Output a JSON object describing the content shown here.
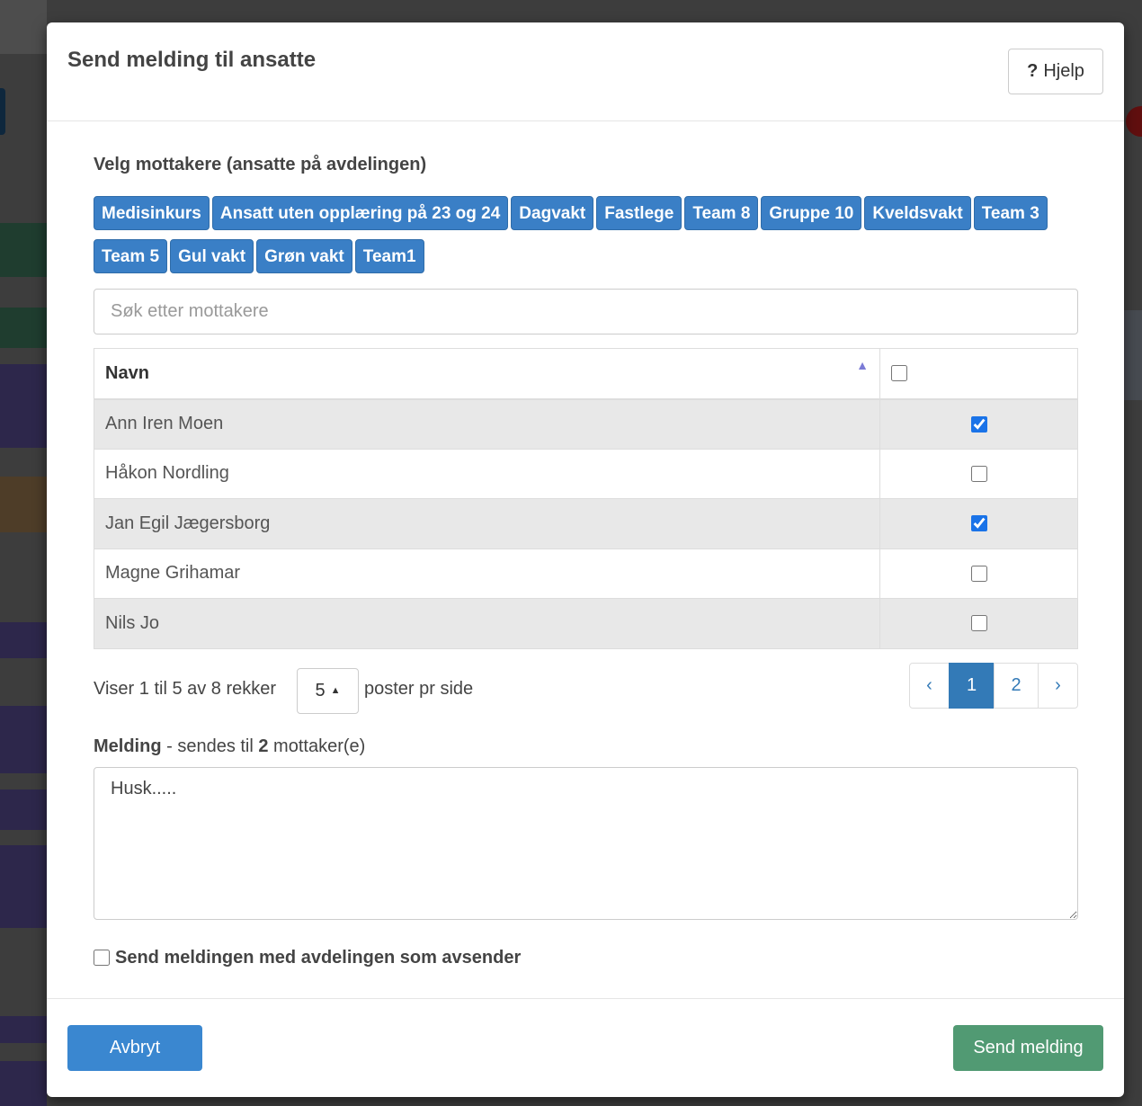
{
  "modal": {
    "title": "Send melding til ansatte",
    "help_label": "Hjelp",
    "recipients_label": "Velg mottakere (ansatte på avdelingen)",
    "groups_row1": [
      "Medisinkurs",
      "Ansatt uten opplæring på 23 og 24",
      "Dagvakt",
      "Fastlege",
      "Team 8",
      "Gruppe 10",
      "Kveldsvakt",
      "Team 3"
    ],
    "groups_row2": [
      "Team 5",
      "Gul vakt",
      "Grøn vakt",
      "Team1"
    ],
    "search_placeholder": "Søk etter mottakere",
    "table": {
      "name_header": "Navn",
      "rows": [
        {
          "name": "Ann Iren Moen",
          "checked": true
        },
        {
          "name": "Håkon Nordling",
          "checked": false
        },
        {
          "name": "Jan Egil Jægersborg",
          "checked": true
        },
        {
          "name": "Magne Grihamar",
          "checked": false
        },
        {
          "name": "Nils Jo",
          "checked": false
        }
      ]
    },
    "pager": {
      "showing": "Viser 1 til 5 av 8 rekker",
      "per_page": "5",
      "per_page_label": "poster pr side",
      "prev": "‹",
      "pages": [
        "1",
        "2"
      ],
      "active_page": "1",
      "next": "›"
    },
    "message": {
      "label_bold": "Melding",
      "label_mid": " - sendes til ",
      "count": "2",
      "label_end": " mottaker(e)",
      "value": "Husk....."
    },
    "send_as_department_label": "Send meldingen med avdelingen som avsender",
    "send_as_department_checked": false,
    "cancel_label": "Avbryt",
    "send_label": "Send melding"
  },
  "colors": {
    "tag": "#3a7fc6",
    "primary": "#337ab7",
    "cancel": "#3a87d0",
    "send": "#519a73"
  }
}
